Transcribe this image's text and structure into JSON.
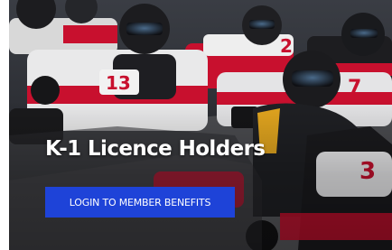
{
  "hero": {
    "title": "K-1 Licence Holders",
    "cta_label": "LOGIN TO MEMBER BENEFITS",
    "kart_numbers": [
      "2",
      "13",
      "7",
      "3"
    ],
    "colors": {
      "cta_background": "#1e43d8",
      "title_text": "#ffffff",
      "kart_red": "#c8102e"
    }
  }
}
